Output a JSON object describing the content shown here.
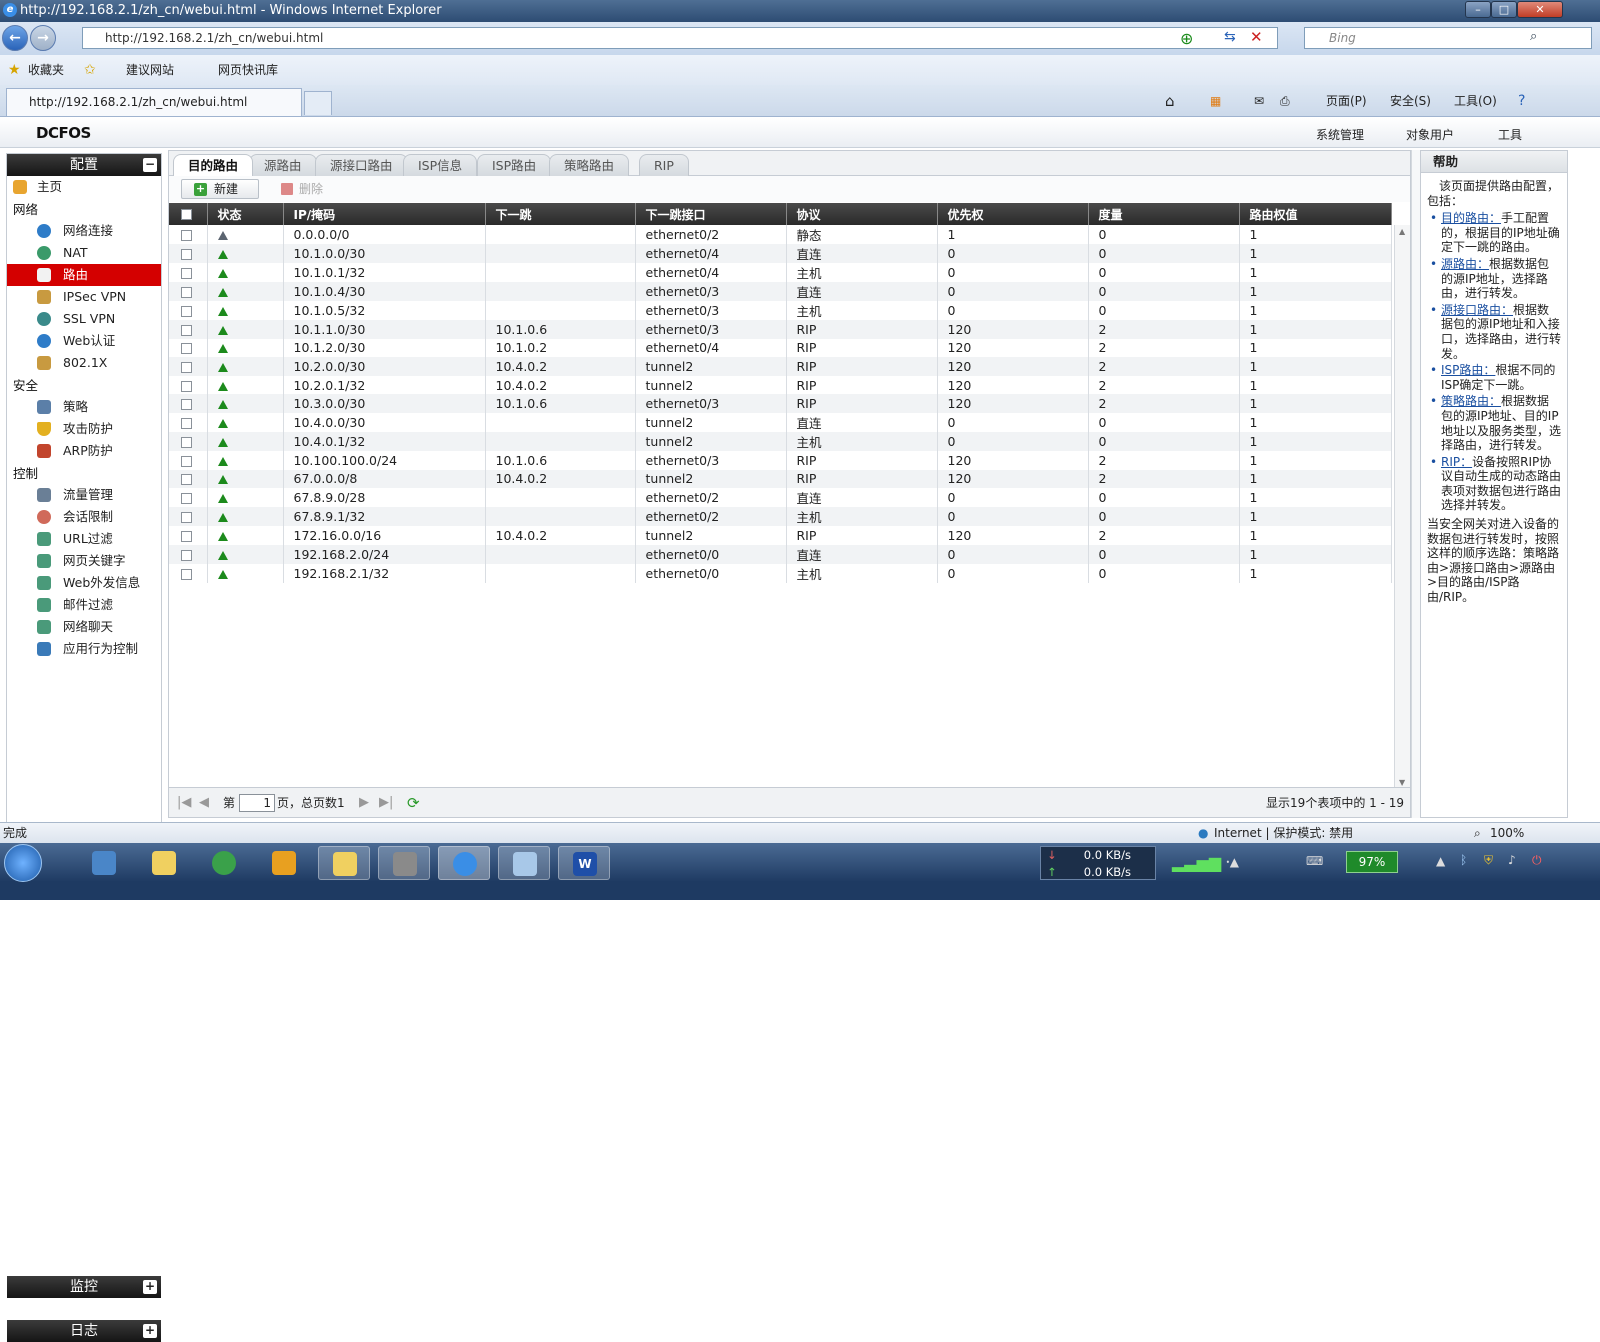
{
  "window": {
    "title": "http://192.168.2.1/zh_cn/webui.html - Windows Internet Explorer",
    "url": "http://192.168.2.1/zh_cn/webui.html",
    "search_placeholder": "Bing"
  },
  "favorites_bar": {
    "favorites": "收藏夹",
    "suggested_sites": "建议网站",
    "web_slice": "网页快讯库"
  },
  "browser_tab": {
    "title": "http://192.168.2.1/zh_cn/webui.html"
  },
  "command_bar": {
    "page": "页面(P)",
    "safety": "安全(S)",
    "tools": "工具(O)"
  },
  "app": {
    "logo": "DCFOS",
    "menus": [
      "系统管理",
      "对象用户",
      "工具"
    ]
  },
  "sidebar": {
    "config_header": "配置",
    "home": "主页",
    "groups": [
      {
        "title": "网络",
        "items": [
          "网络连接",
          "NAT",
          "路由",
          "IPSec VPN",
          "SSL VPN",
          "Web认证",
          "802.1X"
        ]
      },
      {
        "title": "安全",
        "items": [
          "策略",
          "攻击防护",
          "ARP防护"
        ]
      },
      {
        "title": "控制",
        "items": [
          "流量管理",
          "会话限制",
          "URL过滤",
          "网页关键字",
          "Web外发信息",
          "邮件过滤",
          "网络聊天",
          "应用行为控制"
        ]
      }
    ],
    "active_item": "路由",
    "monitor_header": "监控",
    "log_header": "日志"
  },
  "route_tabs": [
    "目的路由",
    "源路由",
    "源接口路由",
    "ISP信息",
    "ISP路由",
    "策略路由",
    "RIP"
  ],
  "toolbar": {
    "new_label": "新建",
    "delete_label": "删除"
  },
  "table": {
    "columns": [
      "状态",
      "IP/掩码",
      "下一跳",
      "下一跳接口",
      "协议",
      "优先权",
      "度量",
      "路由权值"
    ],
    "rows": [
      [
        "0.0.0.0/0",
        "",
        "ethernet0/2",
        "静态",
        "1",
        "0",
        "1"
      ],
      [
        "10.1.0.0/30",
        "",
        "ethernet0/4",
        "直连",
        "0",
        "0",
        "1"
      ],
      [
        "10.1.0.1/32",
        "",
        "ethernet0/4",
        "主机",
        "0",
        "0",
        "1"
      ],
      [
        "10.1.0.4/30",
        "",
        "ethernet0/3",
        "直连",
        "0",
        "0",
        "1"
      ],
      [
        "10.1.0.5/32",
        "",
        "ethernet0/3",
        "主机",
        "0",
        "0",
        "1"
      ],
      [
        "10.1.1.0/30",
        "10.1.0.6",
        "ethernet0/3",
        "RIP",
        "120",
        "2",
        "1"
      ],
      [
        "10.1.2.0/30",
        "10.1.0.2",
        "ethernet0/4",
        "RIP",
        "120",
        "2",
        "1"
      ],
      [
        "10.2.0.0/30",
        "10.4.0.2",
        "tunnel2",
        "RIP",
        "120",
        "2",
        "1"
      ],
      [
        "10.2.0.1/32",
        "10.4.0.2",
        "tunnel2",
        "RIP",
        "120",
        "2",
        "1"
      ],
      [
        "10.3.0.0/30",
        "10.1.0.6",
        "ethernet0/3",
        "RIP",
        "120",
        "2",
        "1"
      ],
      [
        "10.4.0.0/30",
        "",
        "tunnel2",
        "直连",
        "0",
        "0",
        "1"
      ],
      [
        "10.4.0.1/32",
        "",
        "tunnel2",
        "主机",
        "0",
        "0",
        "1"
      ],
      [
        "10.100.100.0/24",
        "10.1.0.6",
        "ethernet0/3",
        "RIP",
        "120",
        "2",
        "1"
      ],
      [
        "67.0.0.0/8",
        "10.4.0.2",
        "tunnel2",
        "RIP",
        "120",
        "2",
        "1"
      ],
      [
        "67.8.9.0/28",
        "",
        "ethernet0/2",
        "直连",
        "0",
        "0",
        "1"
      ],
      [
        "67.8.9.1/32",
        "",
        "ethernet0/2",
        "主机",
        "0",
        "0",
        "1"
      ],
      [
        "172.16.0.0/16",
        "10.4.0.2",
        "tunnel2",
        "RIP",
        "120",
        "2",
        "1"
      ],
      [
        "192.168.2.0/24",
        "",
        "ethernet0/0",
        "直连",
        "0",
        "0",
        "1"
      ],
      [
        "192.168.2.1/32",
        "",
        "ethernet0/0",
        "主机",
        "0",
        "0",
        "1"
      ]
    ]
  },
  "pager": {
    "page_prefix": "第",
    "page_value": "1",
    "page_suffix": "页，总页数1",
    "summary": "显示19个表项中的 1 - 19"
  },
  "help": {
    "title": "帮助",
    "intro": "该页面提供路由配置，包括：",
    "items": [
      {
        "link": "目的路由：",
        "text": "手工配置的，根据目的IP地址确定下一跳的路由。"
      },
      {
        "link": "源路由：",
        "text": "根据数据包的源IP地址，选择路由，进行转发。"
      },
      {
        "link": "源接口路由：",
        "text": "根据数据包的源IP地址和入接口，选择路由，进行转发。"
      },
      {
        "link": "ISP路由：",
        "text": "根据不同的ISP确定下一跳。"
      },
      {
        "link": "策略路由：",
        "text": "根据数据包的源IP地址、目的IP地址以及服务类型，选择路由，进行转发。"
      },
      {
        "link": "RIP：",
        "text": "设备按照RIP协议自动生成的动态路由表项对数据包进行路由选择并转发。"
      }
    ],
    "footer": "当安全网关对进入设备的数据包进行转发时，按照这样的顺序选路：策略路由>源接口路由>源路由>目的路由/ISP路由/RIP。"
  },
  "statusbar": {
    "left": "完成",
    "zone": "Internet | 保护模式: 禁用",
    "zoom": "100%"
  },
  "taskbar": {
    "net_down": "0.0 KB/s",
    "net_up": "0.0 KB/s",
    "battery": "97%"
  },
  "colors": {
    "active_route": "#d40000",
    "status_up": "#1c8a1c",
    "link": "#1a4fa0"
  }
}
